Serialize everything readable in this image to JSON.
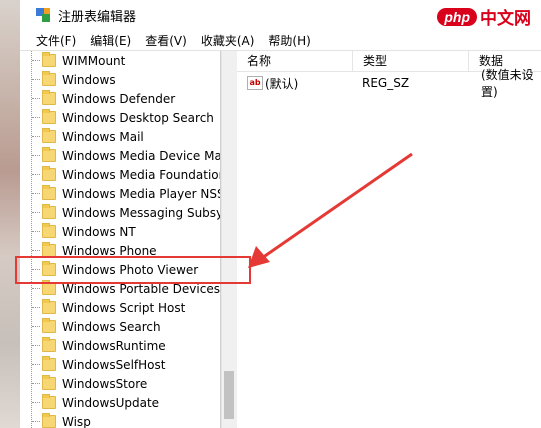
{
  "window": {
    "title": "注册表编辑器",
    "watermark_logo": "php",
    "watermark_text": "中文网"
  },
  "menu": [
    "文件(F)",
    "编辑(E)",
    "查看(V)",
    "收藏夹(A)",
    "帮助(H)"
  ],
  "tree": {
    "items": [
      "WIMMount",
      "Windows",
      "Windows Defender",
      "Windows Desktop Search",
      "Windows Mail",
      "Windows Media Device Mana",
      "Windows Media Foundation",
      "Windows Media Player NSS",
      "Windows Messaging Subsyst",
      "Windows NT",
      "Windows Phone",
      "Windows Photo Viewer",
      "Windows Portable Devices",
      "Windows Script Host",
      "Windows Search",
      "WindowsRuntime",
      "WindowsSelfHost",
      "WindowsStore",
      "WindowsUpdate",
      "Wisp"
    ],
    "highlighted": "Windows Photo Viewer"
  },
  "values": {
    "headers": {
      "name": "名称",
      "type": "类型",
      "data": "数据"
    },
    "rows": [
      {
        "icon": "ab",
        "name": "(默认)",
        "type": "REG_SZ",
        "data": "(数值未设置)"
      }
    ]
  },
  "colors": {
    "annotation": "#e53935",
    "folder": "#f7d774"
  }
}
